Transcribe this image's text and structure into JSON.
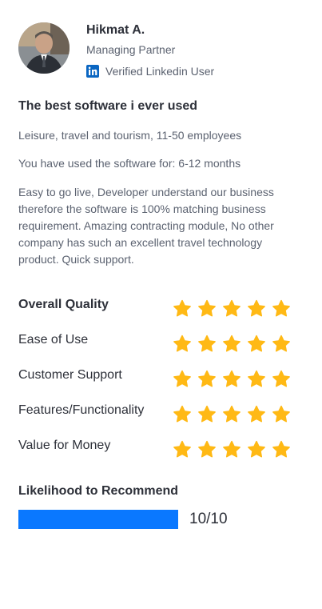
{
  "reviewer": {
    "name": "Hikmat A.",
    "role": "Managing Partner",
    "verified_label": "Verified Linkedin User",
    "verified_icon": "linkedin-icon",
    "avatar": "reviewer-photo"
  },
  "review": {
    "title": "The best software i ever used",
    "industry": "Leisure, travel and tourism, 11-50 employees",
    "usage": "You have used the software for: 6-12 months",
    "body": "Easy to go live, Developer understand our business therefore the software is 100% matching business requirement. Amazing contracting module, No other company has such an excellent travel technology product. Quick support."
  },
  "ratings": [
    {
      "label": "Overall Quality",
      "stars": 5,
      "max": 5
    },
    {
      "label": "Ease of Use",
      "stars": 5,
      "max": 5
    },
    {
      "label": "Customer Support",
      "stars": 5,
      "max": 5
    },
    {
      "label": "Features/Functionality",
      "stars": 5,
      "max": 5
    },
    {
      "label": "Value for Money",
      "stars": 5,
      "max": 5
    }
  ],
  "recommend": {
    "title": "Likelihood to Recommend",
    "value": 10,
    "max": 10,
    "value_text": "10/10"
  },
  "colors": {
    "star": "#FFB915",
    "bar_fill": "#0A78FF",
    "linkedin": "#0A66C2"
  }
}
